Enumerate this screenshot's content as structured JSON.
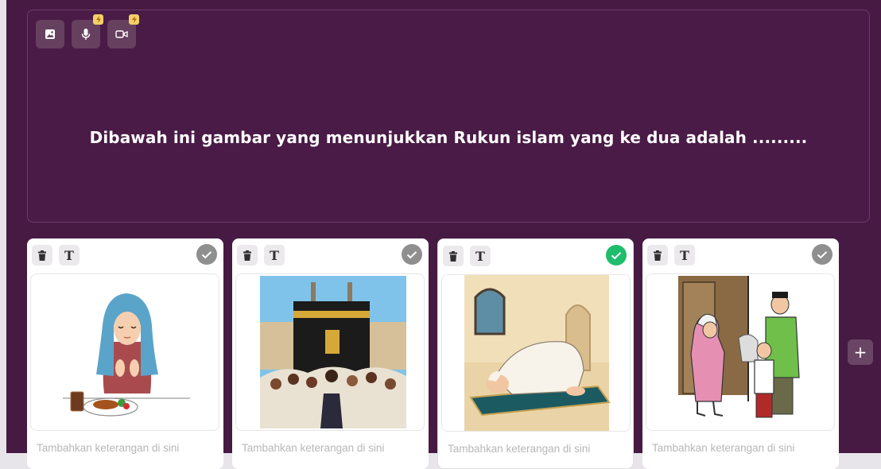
{
  "question": {
    "text": "Dibawah ini gambar yang menunjukkan Rukun islam yang ke dua adalah ........."
  },
  "media_toolbar": [
    {
      "icon": "image-icon"
    },
    {
      "icon": "microphone-icon",
      "premium": true
    },
    {
      "icon": "video-icon",
      "premium": true
    }
  ],
  "options": [
    {
      "image": "girl-eating-praying",
      "caption_placeholder": "Tambahkan keterangan di sini",
      "correct": false
    },
    {
      "image": "kaaba-pilgrims",
      "caption_placeholder": "Tambahkan keterangan di sini",
      "correct": false
    },
    {
      "image": "man-prostrating-prayer",
      "caption_placeholder": "Tambahkan keterangan di sini",
      "correct": true
    },
    {
      "image": "giving-charity",
      "caption_placeholder": "Tambahkan keterangan di sini",
      "correct": false
    }
  ],
  "toolbar_labels": {
    "text_tool": "T",
    "add_option": "+"
  },
  "colors": {
    "background": "#461a43",
    "correct": "#1fbd6b",
    "unchecked": "#8f8f8f",
    "premium_badge": "#f3d068"
  }
}
